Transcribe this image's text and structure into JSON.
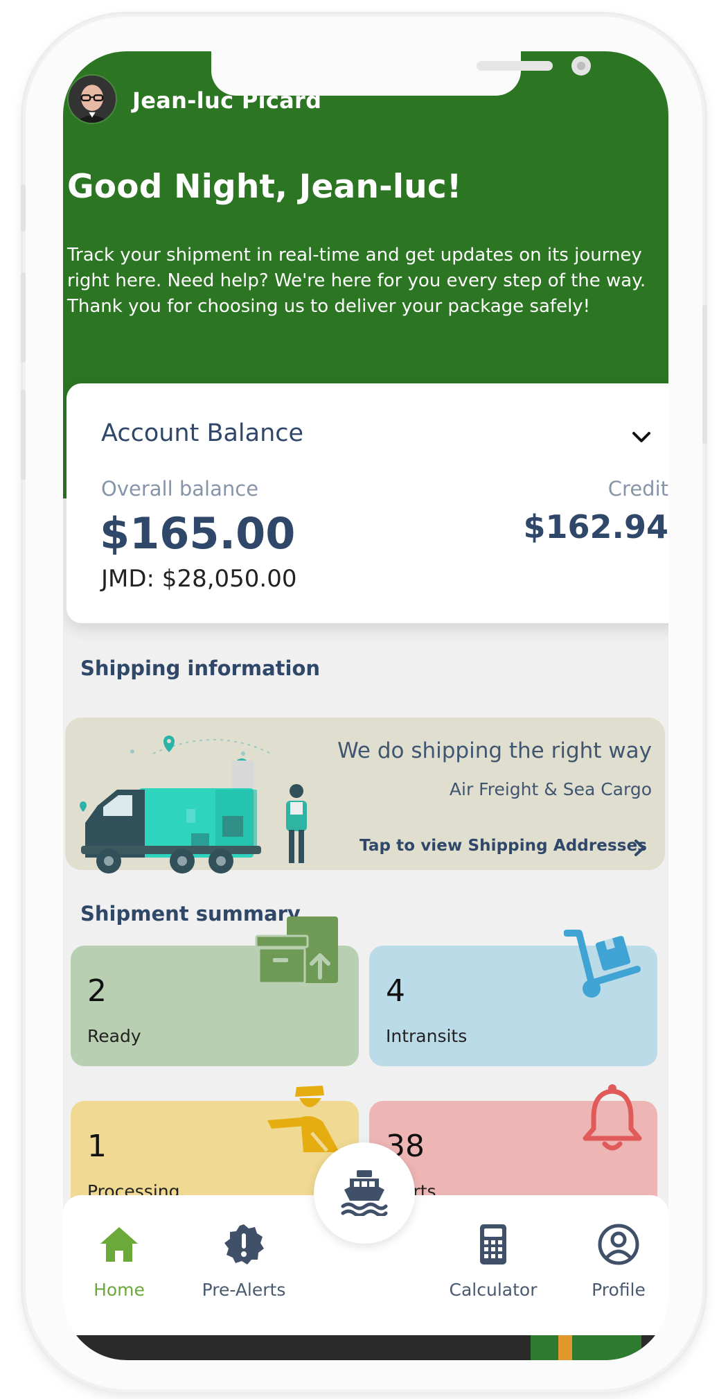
{
  "user": {
    "name": "Jean-luc Picard"
  },
  "header": {
    "greeting": "Good Night, Jean-luc!",
    "intro": "Track your shipment in real-time and get updates on its journey right here. Need help? We're here for you every step of the way. Thank you for choosing us to deliver your package safely!"
  },
  "balance": {
    "title": "Account Balance",
    "overall_label": "Overall balance",
    "overall_value": "$165.00",
    "jmd": "JMD: $28,050.00",
    "credit_label": "Credit",
    "credit_value": "$162.94"
  },
  "shipping": {
    "section_title": "Shipping information",
    "headline": "We do shipping the right way",
    "subline": "Air Freight & Sea Cargo",
    "link": "Tap to view Shipping Addresses"
  },
  "summary": {
    "section_title": "Shipment summary",
    "cards": [
      {
        "count": "2",
        "label": "Ready",
        "icon": "box-upload-icon"
      },
      {
        "count": "4",
        "label": "Intransits",
        "icon": "hand-truck-icon"
      },
      {
        "count": "1",
        "label": "Processing",
        "icon": "courier-icon"
      },
      {
        "count": "38",
        "label": "Alerts",
        "icon": "bell-icon"
      }
    ]
  },
  "nav": {
    "items": [
      {
        "label": "Home",
        "icon": "home-icon",
        "active": true
      },
      {
        "label": "Pre-Alerts",
        "icon": "alert-badge-icon"
      },
      {
        "label": "Calculator",
        "icon": "calculator-icon"
      },
      {
        "label": "Profile",
        "icon": "profile-icon"
      }
    ],
    "center_icon": "ship-icon"
  },
  "colors": {
    "header_green": "#2c7523",
    "navy_text": "#2f4768",
    "active_nav": "#6aa93a",
    "ready": "#b9cfb1",
    "intransit": "#bcdbe8",
    "processing": "#f0d993",
    "alerts": "#eeb5b5"
  }
}
